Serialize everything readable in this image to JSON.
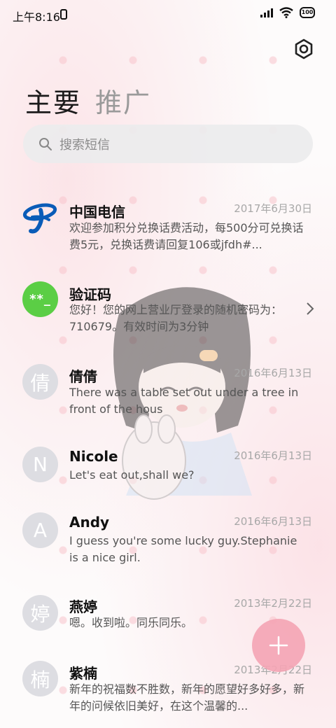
{
  "status_bar": {
    "time": "上午8:16",
    "battery": "100"
  },
  "tabs": [
    {
      "label": "主要"
    },
    {
      "label": "推广"
    }
  ],
  "search": {
    "placeholder": "搜索短信"
  },
  "conversations": [
    {
      "name": "中国电信",
      "date": "2017年6月30日",
      "preview": "欢迎参加积分兑换话费活动，每500分可兑换话费5元，兑换话费请回复106或jfdh#...",
      "avatar": "telecom-logo"
    },
    {
      "name": "验证码",
      "date": "",
      "preview": "您好！您的网上营业厅登录的随机密码为：710679。有效时间为3分钟",
      "avatar_text": "**_"
    },
    {
      "name": "倩倩",
      "date": "2016年6月13日",
      "preview": "There was a table set out under a tree in front of the hous",
      "avatar_text": "倩"
    },
    {
      "name": "Nicole",
      "date": "2016年6月13日",
      "preview": "Let's eat out,shall we?",
      "avatar_text": "N"
    },
    {
      "name": "Andy",
      "date": "2016年6月13日",
      "preview": "I guess you're some lucky guy.Stephanie is a nice girl.",
      "avatar_text": "A"
    },
    {
      "name": "燕婷",
      "date": "2013年2月22日",
      "preview": "嗯。收到啦。同乐同乐。",
      "avatar_text": "婷"
    },
    {
      "name": "紫楠",
      "date": "2013年2月22日",
      "preview": "新年的祝福数不胜数，新年的愿望好多好多，新年的问候依旧美好，在这个温馨的...",
      "avatar_text": "楠"
    }
  ],
  "colors": {
    "accent_fab": "#f4a4b4",
    "verify_avatar": "#5bce45",
    "telecom_blue": "#0a5cb8"
  },
  "icons": {
    "settings": "settings-hexagon-icon",
    "search": "search-icon",
    "fab": "plus-icon",
    "chevron": "chevron-right-icon"
  }
}
